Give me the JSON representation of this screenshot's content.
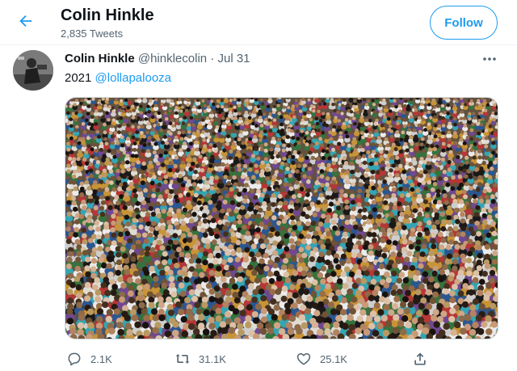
{
  "header": {
    "title": "Colin Hinkle",
    "tweet_count": "2,835 Tweets",
    "follow_label": "Follow"
  },
  "tweet": {
    "author_name": "Colin Hinkle",
    "handle": "@hinklecolin",
    "separator": "·",
    "date": "Jul 31",
    "text_prefix": "2021",
    "mention": "@lollapalooza",
    "replies": "2.1K",
    "retweets": "31.1K",
    "likes": "25.1K"
  },
  "colors": {
    "accent": "#1d9bf0",
    "text_primary": "#0f1419",
    "text_secondary": "#536471"
  },
  "icons": {
    "back": "arrow-left-icon",
    "more": "more-horizontal-icon",
    "reply": "reply-icon",
    "retweet": "retweet-icon",
    "like": "heart-icon",
    "share": "share-icon"
  }
}
